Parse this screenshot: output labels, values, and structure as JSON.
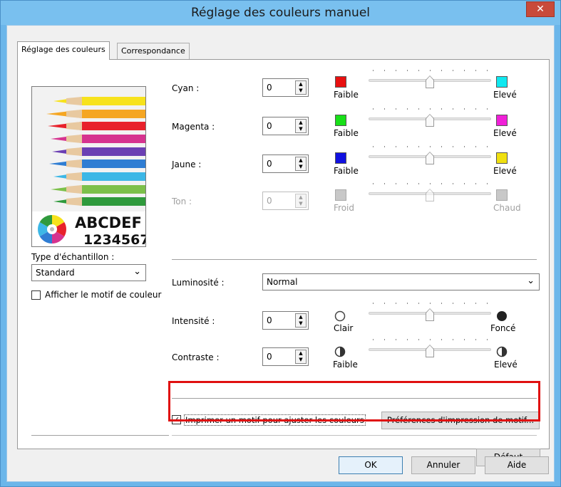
{
  "window": {
    "title": "Réglage des couleurs manuel",
    "close_glyph": "✕"
  },
  "tabs": [
    {
      "label": "Réglage des couleurs",
      "active": true
    },
    {
      "label": "Correspondance",
      "active": false
    }
  ],
  "preview": {
    "line1": "ABCDEF",
    "line2": "1234567"
  },
  "sample_type": {
    "label": "Type d'échantillon :",
    "value": "Standard"
  },
  "show_pattern": {
    "label": "Afficher le motif de couleur",
    "checked": false
  },
  "color_rows": [
    {
      "label": "Cyan :",
      "value": "0",
      "low_label": "Faible",
      "high_label": "Elevé",
      "low_color": "#e81010",
      "high_color": "#10e8f0",
      "level": 0.5,
      "enabled": true
    },
    {
      "label": "Magenta :",
      "value": "0",
      "low_label": "Faible",
      "high_label": "Elevé",
      "low_color": "#18e018",
      "high_color": "#f020d8",
      "level": 0.5,
      "enabled": true
    },
    {
      "label": "Jaune :",
      "value": "0",
      "low_label": "Faible",
      "high_label": "Elevé",
      "low_color": "#1010e0",
      "high_color": "#f0e010",
      "level": 0.5,
      "enabled": true
    },
    {
      "label": "Ton :",
      "value": "0",
      "low_label": "Froid",
      "high_label": "Chaud",
      "low_color": "#c8c8c8",
      "high_color": "#c8c8c8",
      "level": 0.5,
      "enabled": false
    }
  ],
  "brightness": {
    "label": "Luminosité :",
    "value": "Normal"
  },
  "intensity": {
    "label": "Intensité :",
    "value": "0",
    "low_label": "Clair",
    "high_label": "Foncé",
    "level": 0.5
  },
  "contrast": {
    "label": "Contraste :",
    "value": "0",
    "low_label": "Faible",
    "high_label": "Elevé",
    "level": 0.5
  },
  "print_pattern": {
    "label": "Imprimer un motif pour ajuster les couleurs",
    "checked": true,
    "prefs_button": "Préférences d'impression de motif..."
  },
  "buttons": {
    "default": "Défaut",
    "ok": "OK",
    "cancel": "Annuler",
    "help": "Aide"
  },
  "icons": {
    "spin_up": "▲",
    "spin_down": "▼",
    "dropdown": "⌄",
    "check": "✓"
  },
  "colors": {
    "highlight_frame": "#e01010",
    "title_bar": "#79c0ef"
  }
}
